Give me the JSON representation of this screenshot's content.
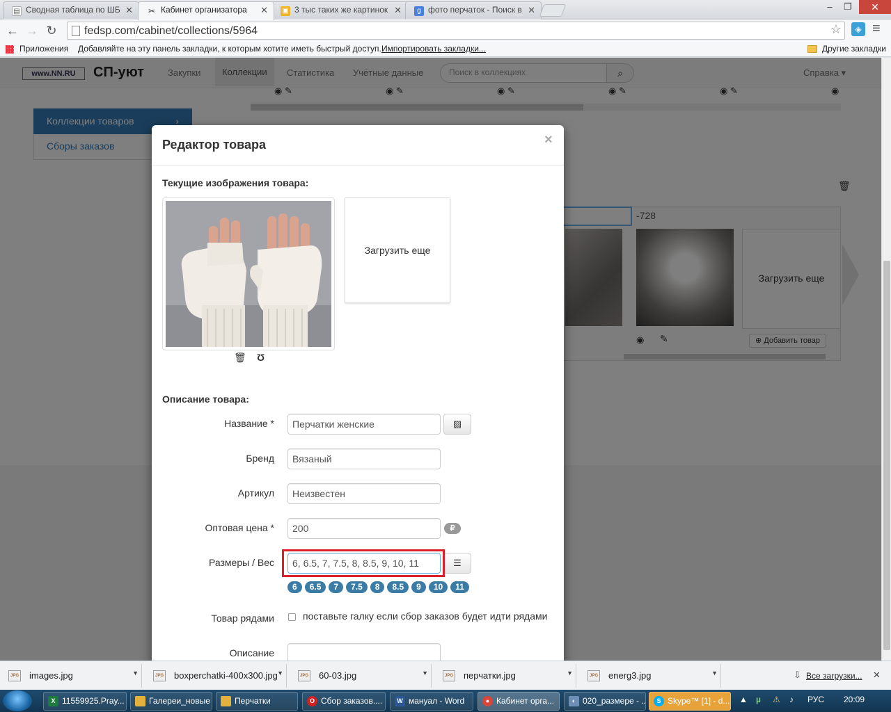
{
  "browser": {
    "tabs": [
      {
        "label": "Сводная таблица по ШБ",
        "icon": "document-icon"
      },
      {
        "label": "Кабинет организатора",
        "icon": "site-icon",
        "active": true
      },
      {
        "label": "3 тыс таких же картинок",
        "icon": "images-icon"
      },
      {
        "label": "фото перчаток - Поиск в",
        "icon": "google-icon"
      }
    ],
    "url": "fedsp.com/cabinet/collections/5964",
    "bookmarks": {
      "apps_label": "Приложения",
      "hint": "Добавляйте на эту панель закладки, к которым хотите иметь быстрый доступ.",
      "import_link": "Импортировать закладки...",
      "other": "Другие закладки"
    }
  },
  "app": {
    "logo": "www.NN.RU",
    "brand": "СП-уют",
    "nav": [
      "Закупки",
      "Коллекции",
      "Статистика",
      "Учётные данные"
    ],
    "search_placeholder": "Поиск в коллекциях",
    "help": "Справка",
    "sidebar": [
      "Коллекции товаров",
      "Сборы заказов"
    ],
    "background": {
      "articul_fragment": "-728",
      "upload_more": "Загрузить еще",
      "add_product": "Добавить товар"
    }
  },
  "modal": {
    "title": "Редактор товара",
    "close": "×",
    "images_heading": "Текущие изображения товара:",
    "upload_more": "Загрузить еще",
    "description_heading": "Описание товара:",
    "fields": {
      "name": {
        "label": "Название *",
        "value": "Перчатки женские"
      },
      "brand": {
        "label": "Бренд",
        "value": "Вязаный"
      },
      "articul": {
        "label": "Артикул",
        "value": "Неизвестен"
      },
      "price": {
        "label": "Оптовая цена *",
        "value": "200",
        "currency": "₽"
      },
      "sizes": {
        "label": "Размеры / Вес",
        "value": "6, 6.5, 7, 7.5, 8, 8.5, 9, 10, 11"
      },
      "rows": {
        "label": "Товар рядами",
        "checkbox_label": "поставьте галку если сбор заказов будет идти рядами"
      },
      "description": {
        "label": "Описание"
      }
    },
    "size_badges": [
      "6",
      "6.5",
      "7",
      "7.5",
      "8",
      "8.5",
      "9",
      "10",
      "11"
    ]
  },
  "downloads": {
    "items": [
      "images.jpg",
      "boxperchatki-400x300.jpg",
      "60-03.jpg",
      "перчатки.jpg",
      "energ3.jpg"
    ],
    "show_all": "Все загрузки...",
    "file_badge": "JPG"
  },
  "taskbar": {
    "items": [
      "11559925.Pray...",
      "Галереи_новые",
      "Перчатки",
      "Сбор заказов....",
      "мануал - Word",
      "Кабинет орга...",
      "020_размере - ...",
      "Skype™ [1] - d..."
    ],
    "language": "РУС",
    "clock": "20:09"
  },
  "colors": {
    "primary": "#337ab7",
    "highlight": "#dd1f2a",
    "badge": "#3a7ca5"
  }
}
